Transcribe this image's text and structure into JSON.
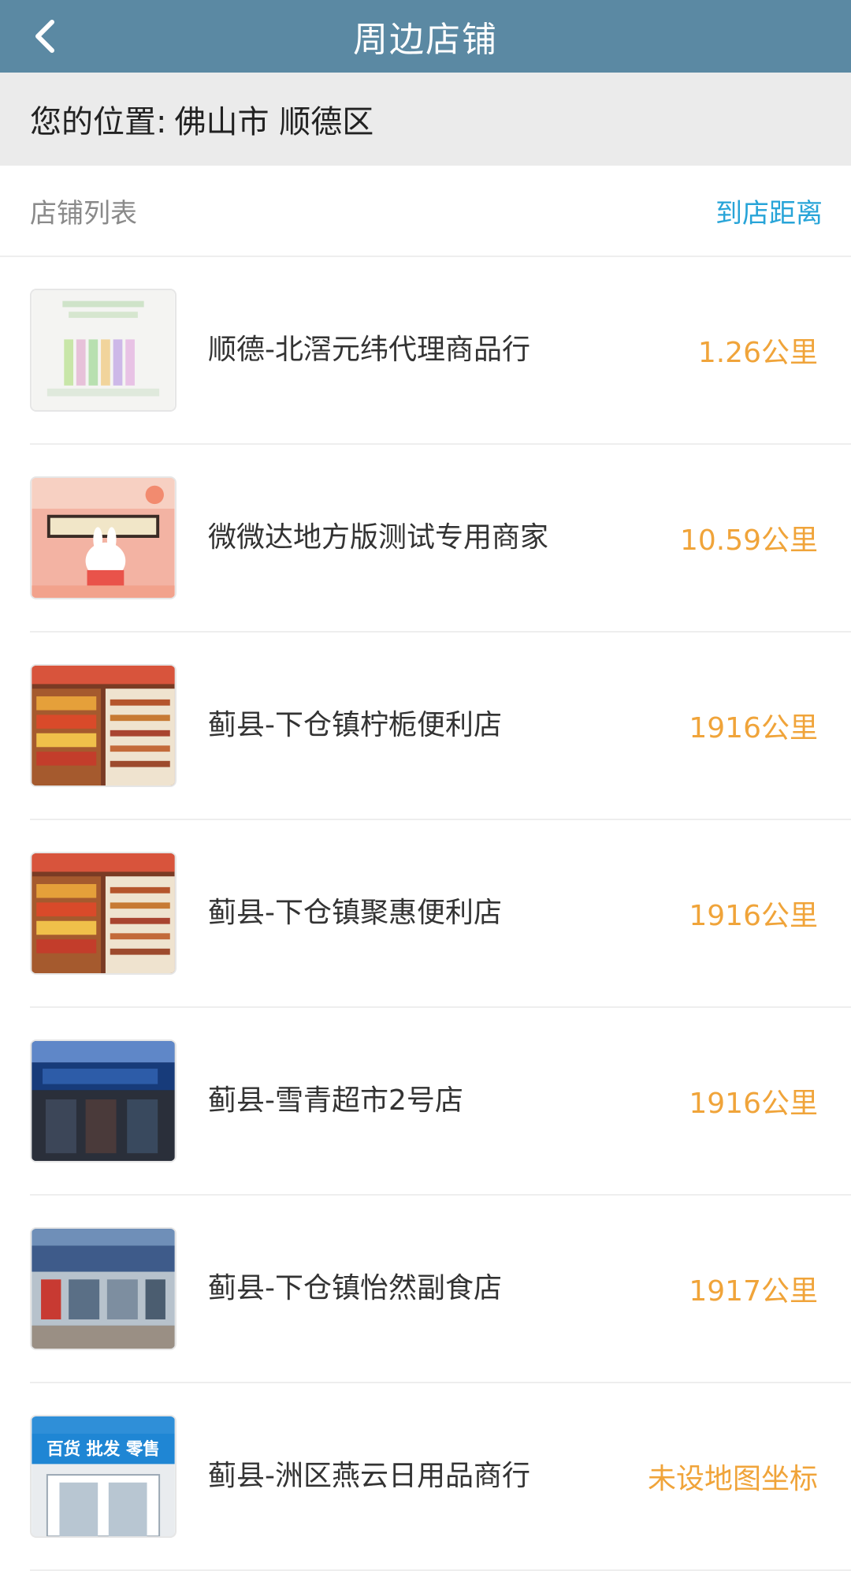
{
  "header": {
    "title": "周边店铺"
  },
  "location": {
    "label": "您的位置:",
    "value": "佛山市 顺德区"
  },
  "list": {
    "title": "店铺列表",
    "sort_label": "到店距离"
  },
  "stores": [
    {
      "name": "顺德-北滘元纬代理商品行",
      "distance": "1.26公里",
      "image": "product-display"
    },
    {
      "name": "微微达地方版测试专用商家",
      "distance": "10.59公里",
      "image": "cartoon-rabbit-banner"
    },
    {
      "name": "蓟县-下仓镇柠栀便利店",
      "distance": "1916公里",
      "image": "shop-shelves"
    },
    {
      "name": "蓟县-下仓镇聚惠便利店",
      "distance": "1916公里",
      "image": "shop-shelves"
    },
    {
      "name": "蓟县-雪青超市2号店",
      "distance": "1916公里",
      "image": "storefront-blue"
    },
    {
      "name": "蓟县-下仓镇怡然副食店",
      "distance": "1917公里",
      "image": "storefront-street"
    },
    {
      "name": "蓟县-洲区燕云日用品商行",
      "distance": "未设地图坐标",
      "image": "sign-board",
      "sign_text": "百货 批发 零售"
    }
  ],
  "colors": {
    "header": "#5b89a3",
    "distance": "#f0a43a",
    "link": "#27a4d8"
  }
}
